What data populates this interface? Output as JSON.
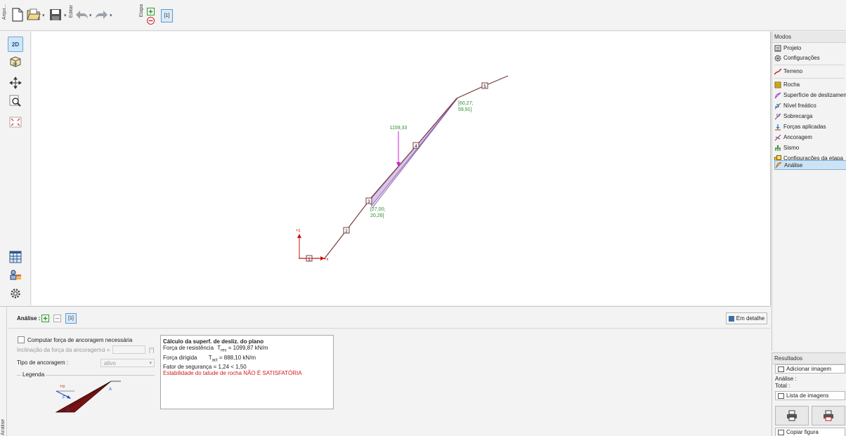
{
  "toolbar": {
    "arquivo_label": "Arqui...",
    "editar_label": "Editar",
    "etapa_label": "Etapa",
    "stage_label": "[1]",
    "icons": [
      "new-file-icon",
      "open-folder-icon",
      "save-icon",
      "undo-icon",
      "redo-icon",
      "add-stage-icon",
      "remove-stage-icon"
    ]
  },
  "left_toolbar": {
    "view_2d_label": "2D",
    "view_3d_label": "3D",
    "icons": [
      "move-icon",
      "zoom-icon",
      "fit-view-icon",
      "table-icon",
      "legend-icon",
      "settings-icon"
    ]
  },
  "canvas": {
    "force_label": "1159,33",
    "point_upper_label_1": "[60,27;",
    "point_upper_label_2": "59,91]",
    "point_lower_label_1": "[27,00;",
    "point_lower_label_2": "20,26]",
    "axis_z": "+z",
    "axis_x": "+x",
    "node_labels": [
      "1",
      "2",
      "3",
      "4",
      "5"
    ],
    "colors": {
      "terrain": "#7a3b3b",
      "wedge": "#9a6fb8",
      "force": "#d21bd2",
      "coords": "#2e8b2e",
      "axis": "#d01010"
    }
  },
  "modes": {
    "title": "Modos",
    "items": [
      {
        "label": "Projeto",
        "icon": "project-icon"
      },
      {
        "label": "Configurações",
        "icon": "gear-icon"
      },
      {
        "label": "Terreno",
        "icon": "terrain-icon"
      },
      {
        "label": "Rocha",
        "icon": "rock-icon"
      },
      {
        "label": "Superfície de deslizamento",
        "icon": "slip-surface-icon"
      },
      {
        "label": "Nível freático",
        "icon": "water-table-icon"
      },
      {
        "label": "Sobrecarga",
        "icon": "surcharge-icon"
      },
      {
        "label": "Forças aplicadas",
        "icon": "applied-forces-icon"
      },
      {
        "label": "Ancoragem",
        "icon": "anchor-icon"
      },
      {
        "label": "Sismo",
        "icon": "earthquake-icon"
      },
      {
        "label": "Configurações da etapa",
        "icon": "stage-settings-icon"
      },
      {
        "label": "Análise",
        "icon": "analysis-icon"
      }
    ]
  },
  "results": {
    "title": "Resultados",
    "add_image": "Adicionar imagem",
    "analise": "Análise :",
    "total": "Total :",
    "image_list": "Lista de imagens",
    "copy_figure": "Copiar figura"
  },
  "analysis": {
    "header": "Análise :",
    "stage": "[1]",
    "detail_button": "Em detalhe",
    "side_label": "Análise",
    "compute_checkbox": "Computar força de ancoragem necessária",
    "inclination_label": "Inclinação da força da ancoragem :",
    "alpha_label": "α =",
    "unit": "[°]",
    "anchor_type_label": "Tipo de ancoragem :",
    "anchor_type_value": "ativo",
    "legend_label": "Legenda",
    "legend_marks": {
      "alpha": "+α",
      "f": "F",
      "a": "A",
      "c": "C"
    }
  },
  "results_box": {
    "title": "Cálculo da superf. de desliz. do plano",
    "res_label": "Força de resistência",
    "res_symbol": "T",
    "res_sub": "res",
    "res_value": "=  1099,87  kN/m",
    "act_label": "Força dirigida",
    "act_symbol": "T",
    "act_sub": "act",
    "act_value": "=   888,10  kN/m",
    "factor": "Fator de segurança = 1,24 < 1,50",
    "verdict": "Estabilidade do talude de rocha NÃO É SATISFATÓRIA"
  }
}
